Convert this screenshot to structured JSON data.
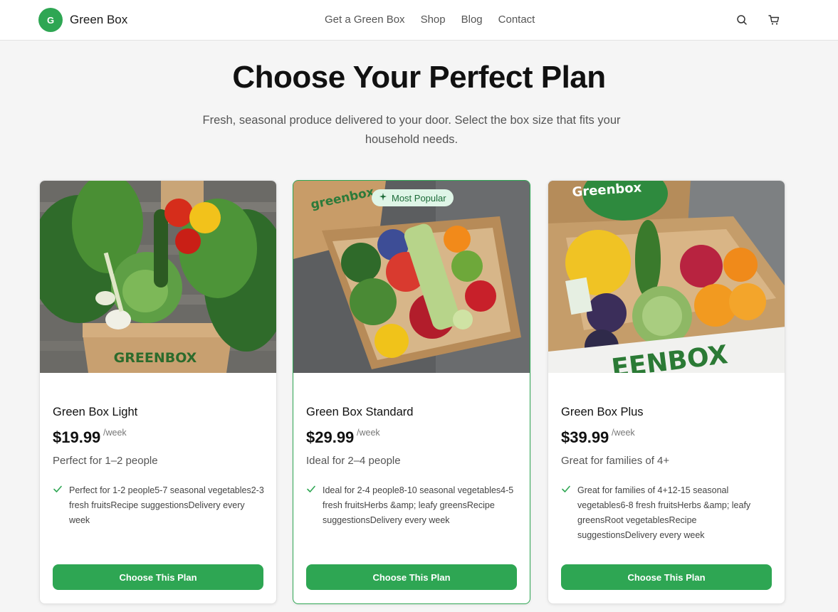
{
  "header": {
    "logo_letter": "G",
    "brand": "Green Box",
    "nav": [
      "Get a Green Box",
      "Shop",
      "Blog",
      "Contact"
    ],
    "icons": [
      "search-icon",
      "cart-icon"
    ]
  },
  "hero": {
    "title": "Choose Your Perfect Plan",
    "subtitle": "Fresh, seasonal produce delivered to your door. Select the box size that fits your household needs."
  },
  "plans": [
    {
      "name": "Green Box Light",
      "price": "$19.99",
      "period": "/week",
      "tagline": "Perfect for 1–2 people",
      "features": "Perfect for 1-2 people5-7 seasonal vegetables2-3 fresh fruitsRecipe suggestionsDelivery every week",
      "cta": "Choose This Plan",
      "featured": false
    },
    {
      "name": "Green Box Standard",
      "price": "$29.99",
      "period": "/week",
      "tagline": "Ideal for 2–4 people",
      "features": "Ideal for 2-4 people8-10 seasonal vegetables4-5 fresh fruitsHerbs &amp; leafy greensRecipe suggestionsDelivery every week",
      "cta": "Choose This Plan",
      "featured": true,
      "badge": "Most Popular"
    },
    {
      "name": "Green Box Plus",
      "price": "$39.99",
      "period": "/week",
      "tagline": "Great for families of 4+",
      "features": "Great for families of 4+12-15 seasonal vegetables6-8 fresh fruitsHerbs &amp; leafy greensRoot vegetablesRecipe suggestionsDelivery every week",
      "cta": "Choose This Plan",
      "featured": false
    }
  ],
  "images": {
    "box_print_light": "GREENBOX",
    "box_print_standard": "greenbox",
    "box_print_plus_lid": "Greenbox",
    "box_print_plus_side": "EENBOX"
  },
  "colors": {
    "accent": "#2ea653",
    "badge_bg": "#dff5e7",
    "badge_text": "#1d6b38"
  }
}
